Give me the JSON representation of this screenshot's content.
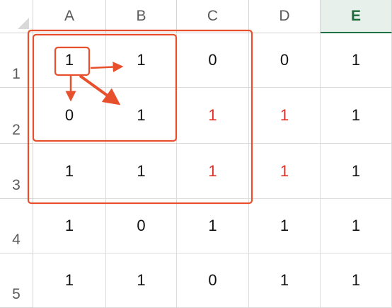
{
  "columns": [
    "A",
    "B",
    "C",
    "D",
    "E"
  ],
  "active_column": "E",
  "rows": [
    "1",
    "2",
    "3",
    "4",
    "5"
  ],
  "cells": [
    [
      {
        "v": "1"
      },
      {
        "v": "1"
      },
      {
        "v": "0"
      },
      {
        "v": "0"
      },
      {
        "v": "1"
      }
    ],
    [
      {
        "v": "0"
      },
      {
        "v": "1"
      },
      {
        "v": "1",
        "red": true
      },
      {
        "v": "1",
        "red": true
      },
      {
        "v": "1"
      }
    ],
    [
      {
        "v": "1"
      },
      {
        "v": "1"
      },
      {
        "v": "1",
        "red": true
      },
      {
        "v": "1",
        "red": true
      },
      {
        "v": "1"
      }
    ],
    [
      {
        "v": "1"
      },
      {
        "v": "0"
      },
      {
        "v": "1"
      },
      {
        "v": "1"
      },
      {
        "v": "1"
      }
    ],
    [
      {
        "v": "1"
      },
      {
        "v": "1"
      },
      {
        "v": "0"
      },
      {
        "v": "1"
      },
      {
        "v": "1"
      }
    ]
  ],
  "colors": {
    "annotation": "#e8502d",
    "highlight_text": "#e0312a",
    "active_header_text": "#1e6b3a"
  }
}
